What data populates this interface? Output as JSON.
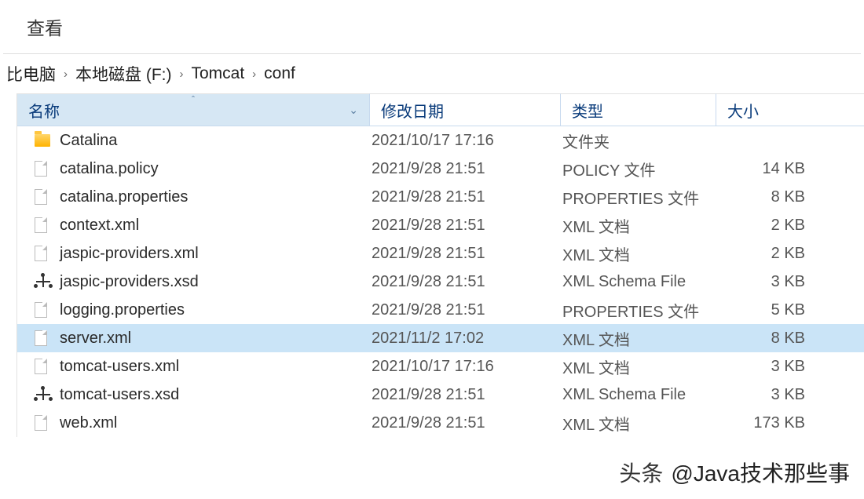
{
  "toolbar": {
    "view": "查看"
  },
  "breadcrumb": {
    "root": "比电脑",
    "drive": "本地磁盘 (F:)",
    "folder1": "Tomcat",
    "folder2": "conf"
  },
  "columns": {
    "name": "名称",
    "date": "修改日期",
    "type": "类型",
    "size": "大小"
  },
  "files": [
    {
      "icon": "folder",
      "name": "Catalina",
      "date": "2021/10/17 17:16",
      "type": "文件夹",
      "size": "",
      "selected": false
    },
    {
      "icon": "file",
      "name": "catalina.policy",
      "date": "2021/9/28 21:51",
      "type": "POLICY 文件",
      "size": "14 KB",
      "selected": false
    },
    {
      "icon": "file",
      "name": "catalina.properties",
      "date": "2021/9/28 21:51",
      "type": "PROPERTIES 文件",
      "size": "8 KB",
      "selected": false
    },
    {
      "icon": "file",
      "name": "context.xml",
      "date": "2021/9/28 21:51",
      "type": "XML 文档",
      "size": "2 KB",
      "selected": false
    },
    {
      "icon": "file",
      "name": "jaspic-providers.xml",
      "date": "2021/9/28 21:51",
      "type": "XML 文档",
      "size": "2 KB",
      "selected": false
    },
    {
      "icon": "xsd",
      "name": "jaspic-providers.xsd",
      "date": "2021/9/28 21:51",
      "type": "XML Schema File",
      "size": "3 KB",
      "selected": false
    },
    {
      "icon": "file",
      "name": "logging.properties",
      "date": "2021/9/28 21:51",
      "type": "PROPERTIES 文件",
      "size": "5 KB",
      "selected": false
    },
    {
      "icon": "file",
      "name": "server.xml",
      "date": "2021/11/2 17:02",
      "type": "XML 文档",
      "size": "8 KB",
      "selected": true
    },
    {
      "icon": "file",
      "name": "tomcat-users.xml",
      "date": "2021/10/17 17:16",
      "type": "XML 文档",
      "size": "3 KB",
      "selected": false
    },
    {
      "icon": "xsd",
      "name": "tomcat-users.xsd",
      "date": "2021/9/28 21:51",
      "type": "XML Schema File",
      "size": "3 KB",
      "selected": false
    },
    {
      "icon": "file",
      "name": "web.xml",
      "date": "2021/9/28 21:51",
      "type": "XML 文档",
      "size": "173 KB",
      "selected": false
    }
  ],
  "watermark": {
    "prefix": "头条",
    "author": "@Java技术那些事"
  }
}
